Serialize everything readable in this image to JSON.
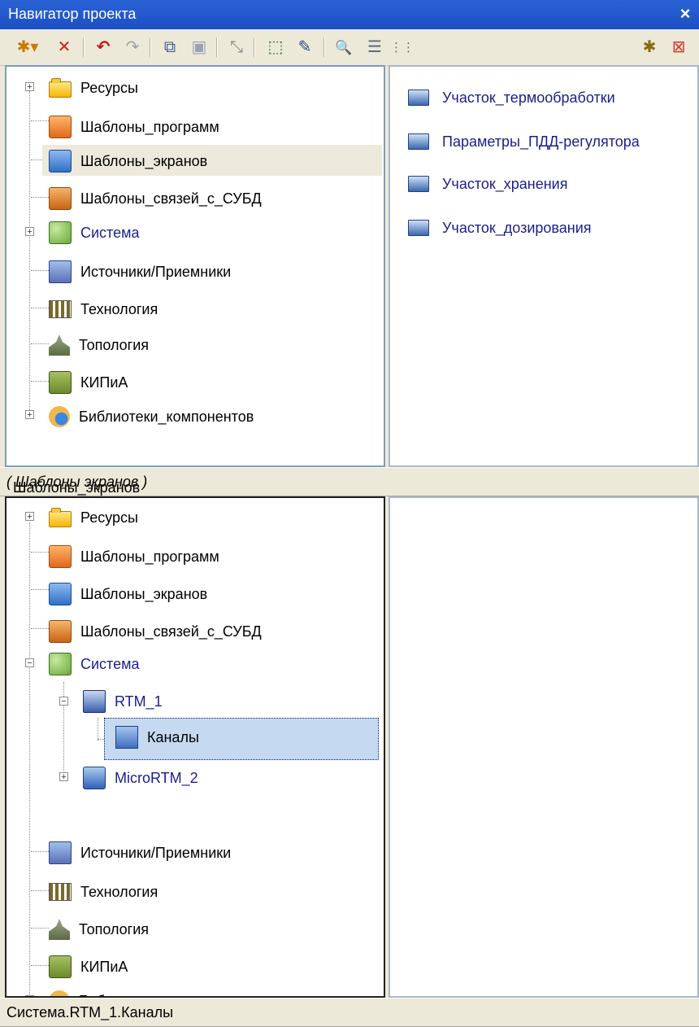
{
  "window": {
    "title": "Навигатор проекта",
    "close_glyph": "×"
  },
  "toolbar": {
    "buttons": [
      {
        "name": "new-item-icon",
        "glyph": "✱▾"
      },
      {
        "name": "delete-icon",
        "glyph": "✕"
      },
      {
        "name": "undo-icon",
        "glyph": "↶"
      },
      {
        "name": "redo-icon",
        "glyph": "↷"
      },
      {
        "name": "copy-icon",
        "glyph": "⧉"
      },
      {
        "name": "paste-icon",
        "glyph": "▣"
      },
      {
        "name": "resize-icon",
        "glyph": "⤡"
      },
      {
        "name": "properties-icon",
        "glyph": "⬚"
      },
      {
        "name": "edit-icon",
        "glyph": "✎"
      },
      {
        "name": "find-icon",
        "glyph": "🔍"
      },
      {
        "name": "tree-view-icon",
        "glyph": "☰"
      },
      {
        "name": "list-view-icon",
        "glyph": "⋮⋮"
      },
      {
        "name": "new-window-icon",
        "glyph": "✱"
      },
      {
        "name": "close-pane-icon",
        "glyph": "⊠"
      }
    ]
  },
  "top_tree": [
    {
      "label": "Ресурсы",
      "icon": "folder"
    },
    {
      "label": "Шаблоны_программ",
      "icon": "orange"
    },
    {
      "label": "Шаблоны_экранов",
      "icon": "blue"
    },
    {
      "label": "Шаблоны_связей_с_СУБД",
      "icon": "orange2"
    },
    {
      "label": "Система",
      "icon": "net"
    },
    {
      "label": "Источники/Приемники",
      "icon": "src"
    },
    {
      "label": "Технология",
      "icon": "tech"
    },
    {
      "label": "Топология",
      "icon": "topo"
    },
    {
      "label": "КИПиА",
      "icon": "kip"
    },
    {
      "label": "Библиотеки_компонентов",
      "icon": "lib"
    }
  ],
  "top_list": [
    {
      "label": "Участок_термообработки"
    },
    {
      "label": "Параметры_ПДД-регулятора"
    },
    {
      "label": "Участок_хранения"
    },
    {
      "label": "Участок_дозирования"
    }
  ],
  "status_top": {
    "main": "Шаблоны_экранов",
    "italic": "( Шаблоны экранов )"
  },
  "bottom_tree": [
    {
      "label": "Ресурсы",
      "icon": "folder"
    },
    {
      "label": "Шаблоны_программ",
      "icon": "orange"
    },
    {
      "label": "Шаблоны_экранов",
      "icon": "blue"
    },
    {
      "label": "Шаблоны_связей_с_СУБД",
      "icon": "orange2"
    },
    {
      "label": "Система",
      "icon": "net"
    },
    {
      "label": "RTM_1",
      "icon": "rtm"
    },
    {
      "label": "Каналы",
      "icon": "chan"
    },
    {
      "label": "MicroRTM_2",
      "icon": "micro"
    },
    {
      "label": "Источники/Приемники",
      "icon": "src"
    },
    {
      "label": "Технология",
      "icon": "tech"
    },
    {
      "label": "Топология",
      "icon": "topo"
    },
    {
      "label": "КИПиА",
      "icon": "kip"
    },
    {
      "label": "Библиотеки_компонентов",
      "icon": "lib"
    }
  ],
  "status_bottom": {
    "text": "Система.RTM_1.Каналы"
  },
  "colors": {
    "title_bar": "#1c4fc4",
    "link": "#1a1f8a",
    "selection": "#c5d9f1",
    "pane_border": "#7f9db9"
  }
}
